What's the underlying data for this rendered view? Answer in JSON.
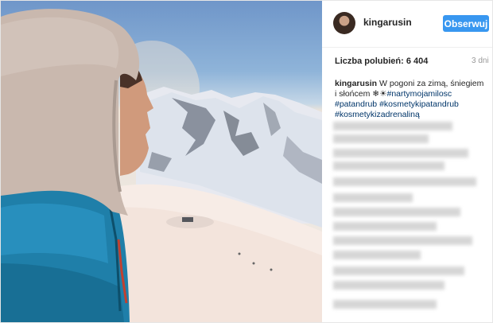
{
  "post": {
    "username": "kingarusin",
    "follow_label": "Obserwuj",
    "likes": "Liczba polubień: 6 404",
    "time": "3 dni",
    "caption": {
      "user": "kingarusin",
      "text": " W pogoni za zimą, śniegiem i słońcem  ❄☀",
      "tags": [
        "#nartymojamilosc",
        "#patandrub",
        "#kosmetykipatandrub",
        "#kosmetykizadrenaliną"
      ]
    }
  },
  "colors": {
    "follow_bg": "#3897f0",
    "hashtag": "#003569",
    "jacket": "#1f7fa9",
    "hood": "#c9b8ae"
  }
}
